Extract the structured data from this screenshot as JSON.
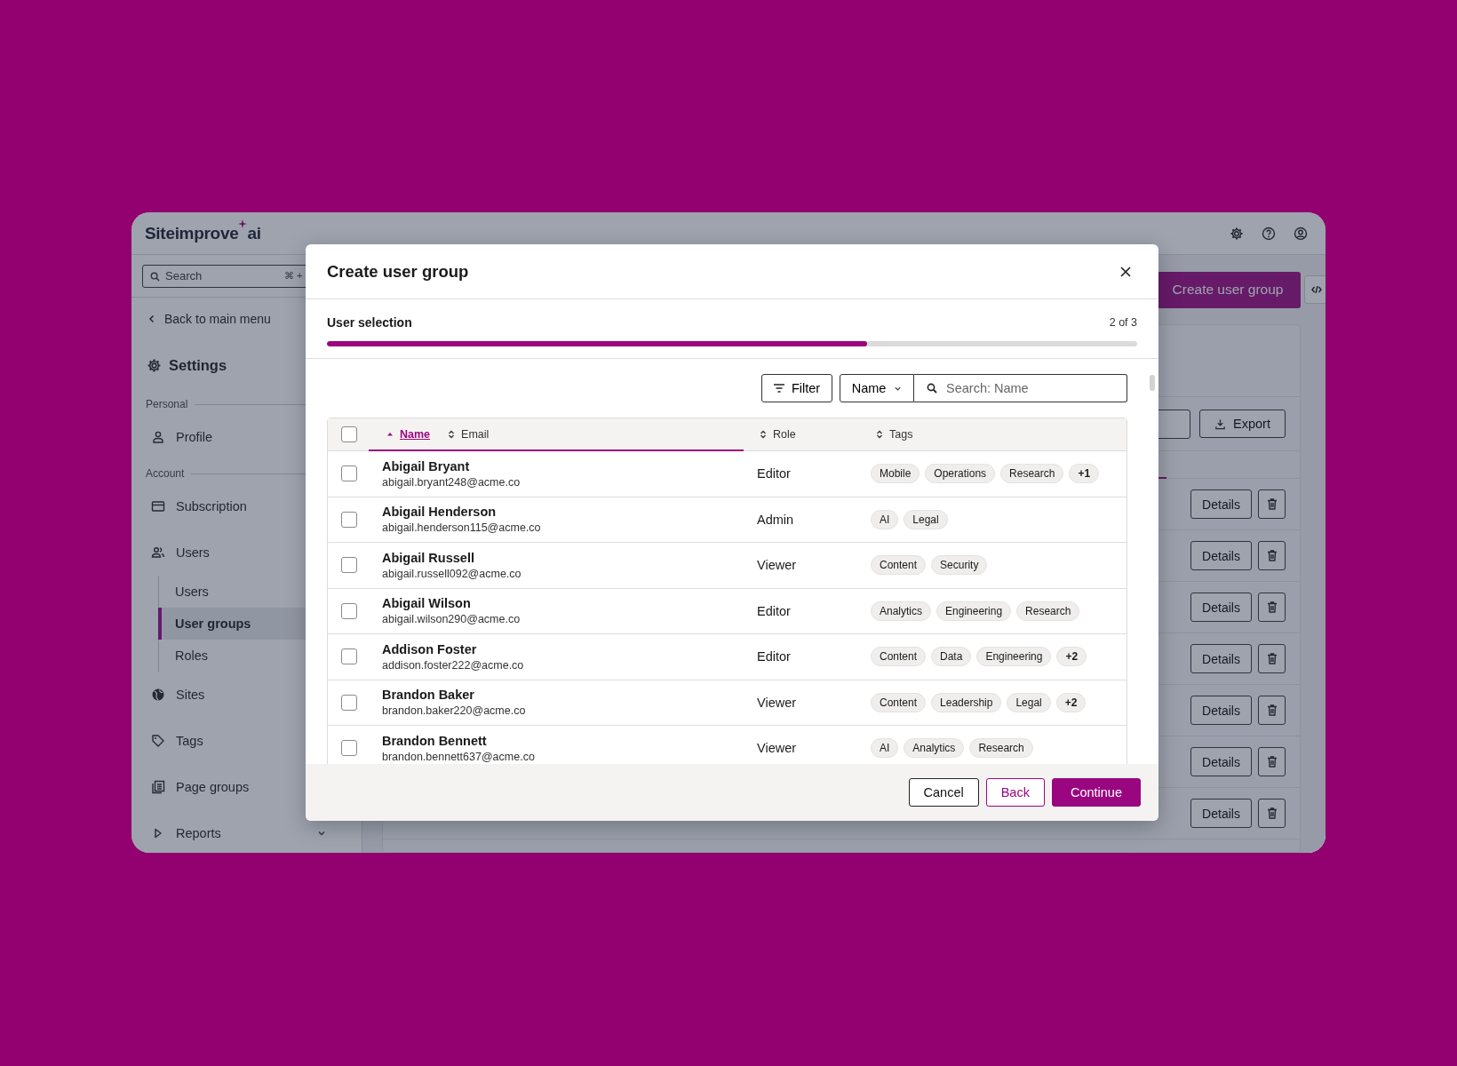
{
  "app": {
    "logo": {
      "name": "Siteimprove",
      "suffix": "ai"
    },
    "sidebar": {
      "search": {
        "placeholder": "Search",
        "shortcut": "⌘ +"
      },
      "back": "Back to main menu",
      "title": "Settings",
      "sections": [
        {
          "label": "Personal",
          "items": [
            {
              "label": "Profile"
            }
          ]
        },
        {
          "label": "Account",
          "items": [
            {
              "label": "Subscription"
            },
            {
              "label": "Users",
              "expanded": true,
              "children": [
                {
                  "label": "Users",
                  "selected": false
                },
                {
                  "label": "User groups",
                  "selected": true
                },
                {
                  "label": "Roles",
                  "selected": false
                }
              ]
            },
            {
              "label": "Sites"
            },
            {
              "label": "Tags"
            },
            {
              "label": "Page groups"
            },
            {
              "label": "Reports",
              "expanded": false
            }
          ]
        }
      ]
    },
    "main": {
      "create_button": "Create user group",
      "export_button": "Export",
      "rows": [
        {
          "action": "Details"
        },
        {
          "action": "Details"
        },
        {
          "action": "Details"
        },
        {
          "action": "Details"
        },
        {
          "action": "Details"
        },
        {
          "action": "Details"
        },
        {
          "action": "Details"
        }
      ]
    }
  },
  "modal": {
    "title": "Create user group",
    "step": {
      "label": "User selection",
      "count": "2 of 3",
      "level": 0.667
    },
    "toolbar": {
      "filter": "Filter",
      "field": "Name",
      "search_placeholder": "Search: Name"
    },
    "table": {
      "all_checked": false,
      "columns": [
        {
          "label": "Name",
          "sorted": true,
          "selected": true
        },
        {
          "label": "Email",
          "sorted": false,
          "selected": false
        },
        {
          "label": "Role",
          "sorted": false,
          "selected": false
        },
        {
          "label": "Tags",
          "sorted": false,
          "selected": false
        }
      ],
      "rows": [
        {
          "name": "Abigail Bryant",
          "email": "abigail.bryant248@acme.co",
          "role": "Editor",
          "tags": [
            "Mobile",
            "Operations",
            "Research"
          ],
          "more": "+1",
          "checked": false
        },
        {
          "name": "Abigail Henderson",
          "email": "abigail.henderson115@acme.co",
          "role": "Admin",
          "tags": [
            "AI",
            "Legal"
          ],
          "checked": false
        },
        {
          "name": "Abigail Russell",
          "email": "abigail.russell092@acme.co",
          "role": "Viewer",
          "tags": [
            "Content",
            "Security"
          ],
          "checked": false
        },
        {
          "name": "Abigail Wilson",
          "email": "abigail.wilson290@acme.co",
          "role": "Editor",
          "tags": [
            "Analytics",
            "Engineering",
            "Research"
          ],
          "checked": false
        },
        {
          "name": "Addison Foster",
          "email": "addison.foster222@acme.co",
          "role": "Editor",
          "tags": [
            "Content",
            "Data",
            "Engineering"
          ],
          "more": "+2",
          "checked": false
        },
        {
          "name": "Brandon Baker",
          "email": "brandon.baker220@acme.co",
          "role": "Viewer",
          "tags": [
            "Content",
            "Leadership",
            "Legal"
          ],
          "more": "+2",
          "checked": false
        },
        {
          "name": "Brandon Bennett",
          "email": "brandon.bennett637@acme.co",
          "role": "Viewer",
          "tags": [
            "AI",
            "Analytics",
            "Research"
          ],
          "checked": false
        }
      ]
    },
    "buttons": [
      {
        "label": "Cancel",
        "kind": "secondary"
      },
      {
        "label": "Back",
        "kind": "outline"
      },
      {
        "label": "Continue",
        "kind": "primary"
      }
    ]
  }
}
